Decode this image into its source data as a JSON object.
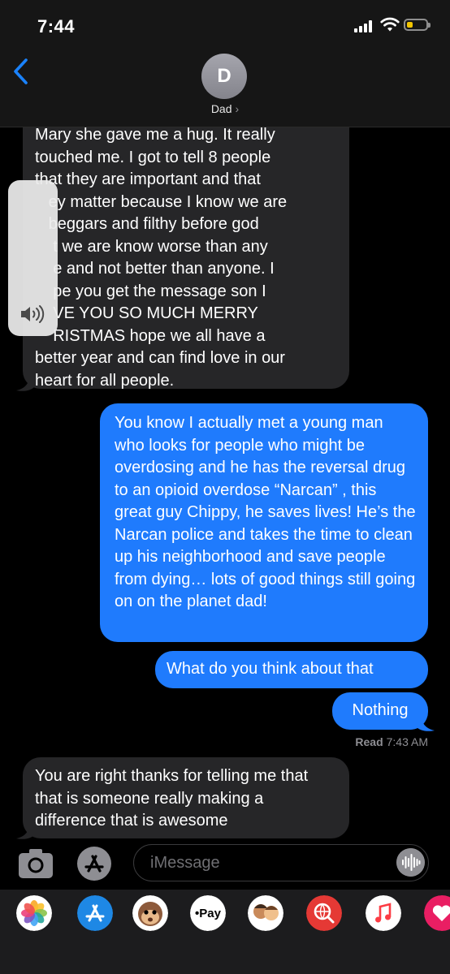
{
  "status_bar": {
    "time": "7:44",
    "battery_level": 0.3
  },
  "header": {
    "avatar_initial": "D",
    "contact_name": "Dad",
    "contact_chevron": "›"
  },
  "messages": [
    {
      "direction": "incoming",
      "lines": [
        "Mary she gave me a hug. It really",
        "touched me.  I got to tell 8 people",
        "that they are important and that",
        "   ey matter because I know we are",
        "   beggars and filthy before god",
        "    t we are know worse than any",
        "    e and not better than anyone.  I",
        "    pe you get the message son I",
        "    VE YOU SO MUCH MERRY",
        "    RISTMAS  hope we all have a",
        "better year and can find love in our",
        "heart for all people."
      ]
    },
    {
      "direction": "outgoing",
      "text": "You know I actually met a young man who looks for people who might be overdosing and he has the reversal drug to an opioid overdose “Narcan” , this great guy Chippy, he saves lives! He’s the Narcan police and takes the time to clean up his neighborhood and save people from dying… lots of good things still going on on the planet dad!"
    },
    {
      "direction": "outgoing",
      "text": "What do you think about that"
    },
    {
      "direction": "outgoing",
      "text": "Nothing"
    },
    {
      "direction": "incoming",
      "text": "You are right thanks for telling me that that is someone really making a difference that is awesome"
    }
  ],
  "read_receipt": {
    "label": "Read",
    "time": "7:43 AM"
  },
  "input": {
    "placeholder": "iMessage"
  },
  "app_drawer": {
    "apps": [
      "photos-icon",
      "app-store-icon",
      "animoji-icon",
      "apple-pay-icon",
      "memoji-icon",
      "web-search-icon",
      "music-icon",
      "heart-sticker-icon"
    ],
    "apple_pay_label": "Pay"
  },
  "colors": {
    "outgoing_bubble": "#1f7bfd",
    "incoming_bubble": "#262628",
    "accent": "#1a82fb"
  }
}
